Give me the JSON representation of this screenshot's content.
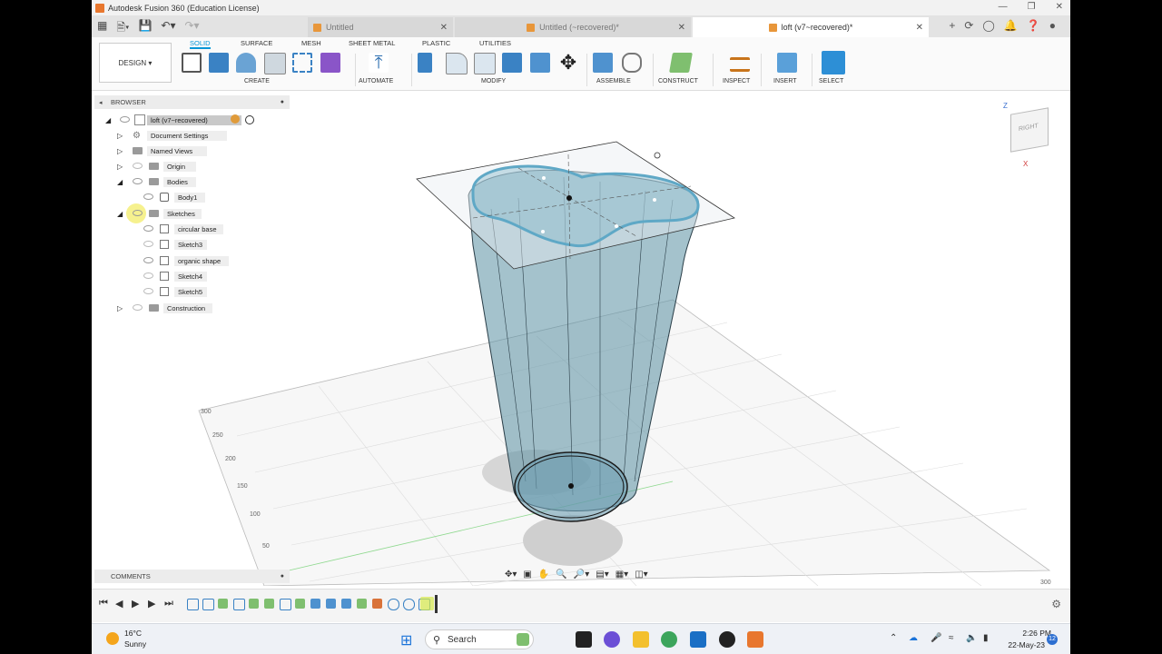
{
  "window": {
    "title": "Autodesk Fusion 360 (Education License)"
  },
  "tabs": [
    {
      "label": "Untitled",
      "active": false
    },
    {
      "label": "Untitled (~recovered)*",
      "active": false
    },
    {
      "label": "loft (v7~recovered)*",
      "active": true
    }
  ],
  "ribbon": {
    "workspace": "DESIGN",
    "tabs": [
      "SOLID",
      "SURFACE",
      "MESH",
      "SHEET METAL",
      "PLASTIC",
      "UTILITIES"
    ],
    "groups": [
      "CREATE",
      "AUTOMATE",
      "MODIFY",
      "ASSEMBLE",
      "CONSTRUCT",
      "INSPECT",
      "INSERT",
      "SELECT"
    ]
  },
  "browser": {
    "title": "BROWSER",
    "root": "loft (v7~recovered)",
    "items": [
      "Document Settings",
      "Named Views",
      "Origin",
      "Bodies",
      "Body1",
      "Sketches",
      "circular base",
      "Sketch3",
      "organic shape",
      "Sketch4",
      "Sketch5",
      "Construction"
    ]
  },
  "comments": {
    "title": "COMMENTS"
  },
  "viewcube": {
    "face": "RIGHT",
    "axis_z": "Z",
    "axis_x": "X"
  },
  "grid_labels": [
    "300",
    "250",
    "200",
    "150",
    "100",
    "50",
    "300"
  ],
  "taskbar": {
    "temperature": "16°C",
    "condition": "Sunny",
    "search": "Search",
    "time": "2:26 PM",
    "date": "22-May-23",
    "notifications": "12"
  },
  "colors": {
    "accent": "#0696d7",
    "body": "#5a8fa3",
    "fusion_orange": "#e8772e"
  }
}
